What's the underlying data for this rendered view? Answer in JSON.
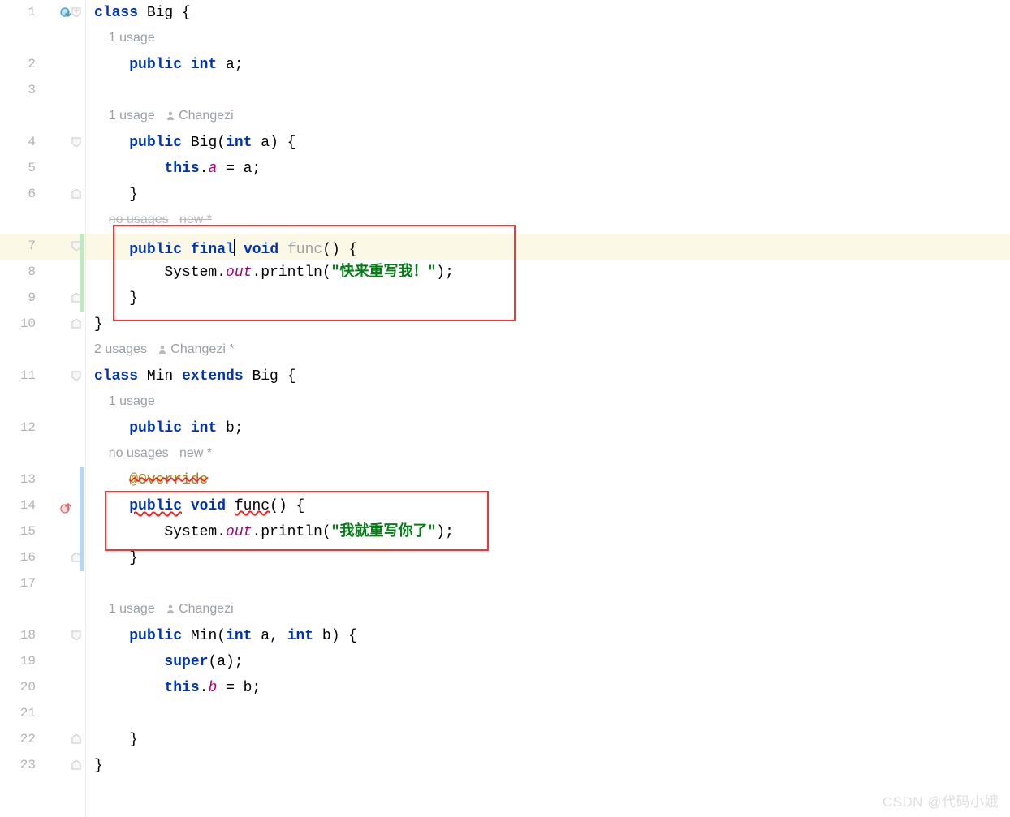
{
  "lines": {
    "l1": "1",
    "l2": "2",
    "l3": "3",
    "l4": "4",
    "l5": "5",
    "l6": "6",
    "l7": "7",
    "l8": "8",
    "l9": "9",
    "l10": "10",
    "l11": "11",
    "l12": "12",
    "l13": "13",
    "l14": "14",
    "l15": "15",
    "l16": "16",
    "l17": "17",
    "l18": "18",
    "l19": "19",
    "l20": "20",
    "l21": "21",
    "l22": "22",
    "l23": "23"
  },
  "hints": {
    "big_a": {
      "indent": "    ",
      "usage": "1 usage"
    },
    "big_ctor": {
      "indent": "    ",
      "usage": "1 usage",
      "author": "Changezi"
    },
    "big_func": {
      "indent": "    ",
      "usage": "no usages",
      "new": "new *"
    },
    "class_min": {
      "indent": "",
      "usage": "2 usages",
      "author": "Changezi *"
    },
    "min_b": {
      "indent": "    ",
      "usage": "1 usage"
    },
    "min_override": {
      "indent": "    ",
      "usage": "no usages",
      "new": "new *"
    },
    "min_ctor": {
      "indent": "    ",
      "usage": "1 usage",
      "author": "Changezi"
    }
  },
  "code": {
    "big_class": {
      "kw": "class",
      "name": " Big {"
    },
    "big_a": {
      "indent": "    ",
      "kws": "public int",
      "rest": " a;"
    },
    "big_ctor_open": {
      "indent": "    ",
      "kw": "public",
      "sp": " ",
      "name": "Big",
      "sig": "(",
      "kw2": "int",
      "rest": " a) {"
    },
    "big_ctor_body": {
      "indent": "        ",
      "kw": "this",
      "dot": ".",
      "field": "a",
      "rest": " = a;"
    },
    "big_ctor_close": {
      "indent": "    ",
      "brace": "}"
    },
    "big_func_open": {
      "indent": "    ",
      "kws": "public final",
      "sp": " ",
      "kw2": "void",
      "sp2": " ",
      "name": "func",
      "rest": "() {"
    },
    "big_func_body": {
      "indent": "        ",
      "sys": "System.",
      "out": "out",
      "print": ".println(",
      "str": "\"快来重写我！\"",
      "end": ");"
    },
    "big_func_close": {
      "indent": "    ",
      "brace": "}"
    },
    "big_close": "}",
    "min_class": {
      "kw": "class",
      "name": " Min ",
      "ext": "extends",
      "rest": " Big {"
    },
    "min_b": {
      "indent": "    ",
      "kws": "public int",
      "rest": " b;"
    },
    "min_override": {
      "indent": "    ",
      "text": "@Override"
    },
    "min_func_open": {
      "indent": "    ",
      "kw": "public",
      "sp": " ",
      "kw2": "void",
      "sp2": " ",
      "name": "func",
      "rest": "() {"
    },
    "min_func_body": {
      "indent": "        ",
      "sys": "System.",
      "out": "out",
      "print": ".println(",
      "str": "\"我就重写你了\"",
      "end": ");"
    },
    "min_func_close": {
      "indent": "    ",
      "brace": "}"
    },
    "min_ctor_open": {
      "indent": "    ",
      "kw": "public",
      "sp": " ",
      "name": "Min",
      "sig": "(",
      "kw2": "int",
      "mid": " a, ",
      "kw3": "int",
      "rest": " b) {"
    },
    "min_ctor_body1": {
      "indent": "        ",
      "kw": "super",
      "rest": "(a);"
    },
    "min_ctor_body2": {
      "indent": "        ",
      "kw": "this",
      "dot": ".",
      "field": "b",
      "rest": " = b;"
    },
    "blank": "",
    "min_ctor_close": {
      "indent": "    ",
      "brace": "}"
    },
    "min_close": "}"
  },
  "watermark": "CSDN @代码小娥"
}
